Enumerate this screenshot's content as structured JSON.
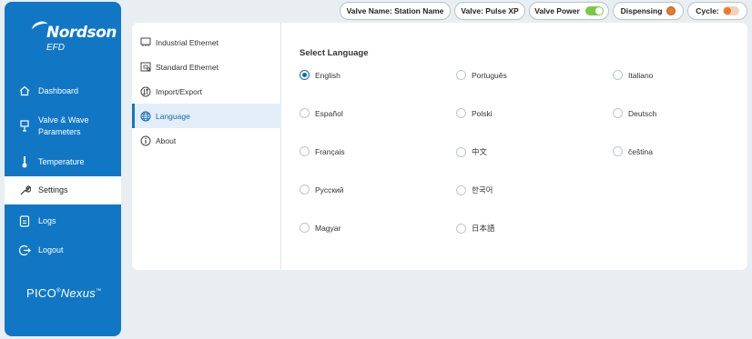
{
  "brand": {
    "name": "Nordson",
    "sub": "EFD",
    "product": "PICO",
    "product_suffix": "Nexus"
  },
  "nav": {
    "items": [
      {
        "label": "Dashboard",
        "icon": "home-icon"
      },
      {
        "label": "Valve & Wave",
        "label2": "Parameters",
        "icon": "valve-icon"
      },
      {
        "label": "Temperature",
        "icon": "thermometer-icon"
      },
      {
        "label": "Settings",
        "icon": "wrench-icon",
        "active": true
      },
      {
        "label": "Logs",
        "icon": "logs-icon"
      },
      {
        "label": "Logout",
        "icon": "logout-icon"
      }
    ]
  },
  "status": {
    "valve_name_label": "Valve Name:",
    "valve_name_value": "Station Name",
    "valve_label": "Valve:",
    "valve_value": "Pulse XP",
    "valve_power_label": "Valve Power",
    "valve_power_on": true,
    "dispensing_label": "Dispensing",
    "cycle_label": "Cycle:",
    "colors": {
      "power_on": "#7ac943",
      "dispensing": "#e8792b",
      "cycle": "#e8792b",
      "accent": "#1177c5"
    }
  },
  "submenu": {
    "items": [
      {
        "label": "Industrial Ethernet",
        "icon": "ethernet-icon"
      },
      {
        "label": "Standard Ethernet",
        "icon": "network-icon"
      },
      {
        "label": "Import/Export",
        "icon": "import-export-icon"
      },
      {
        "label": "Language",
        "icon": "globe-icon",
        "active": true
      },
      {
        "label": "About",
        "icon": "info-icon"
      }
    ]
  },
  "language": {
    "title": "Select Language",
    "selected": "English",
    "options": [
      "English",
      "Português",
      "Italiano",
      "Español",
      "Polski",
      "Deutsch",
      "Français",
      "中文",
      "čeština",
      "Русский",
      "한국어",
      "Magyar",
      "日本語"
    ]
  }
}
